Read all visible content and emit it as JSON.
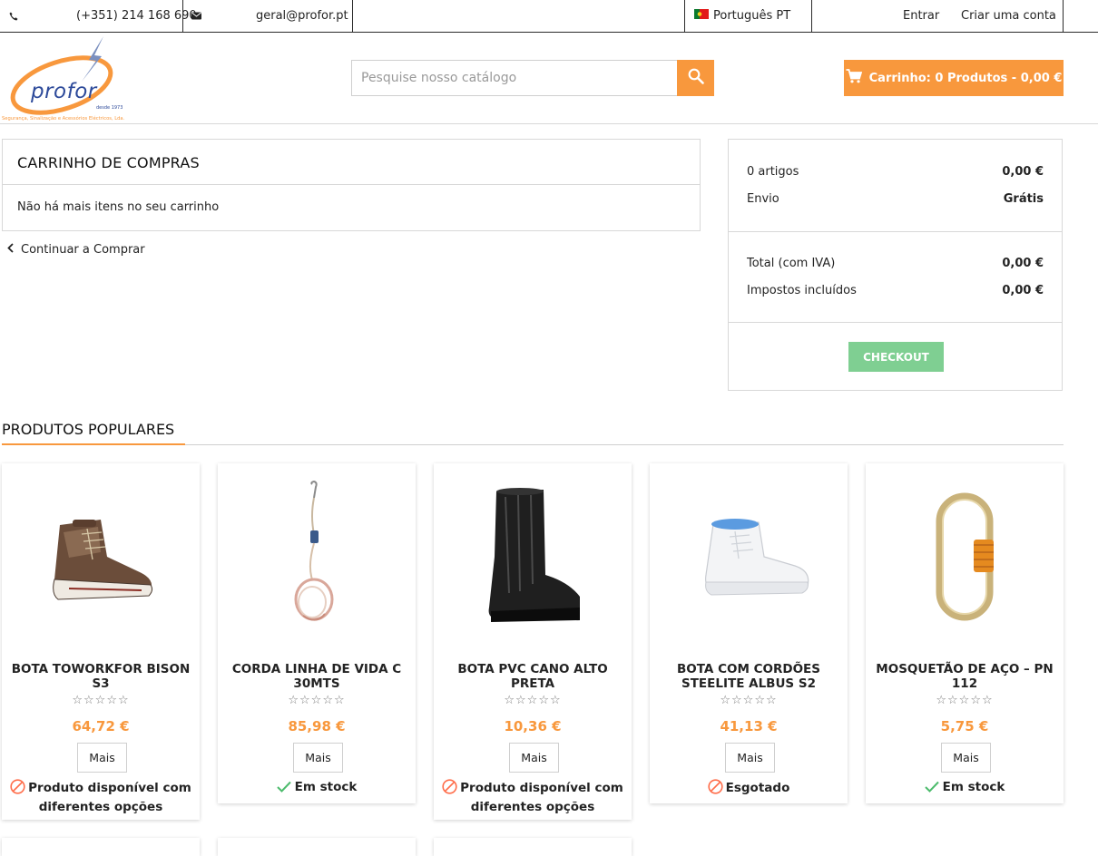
{
  "topbar": {
    "phone": "(+351) 214 168 690",
    "email": "geral@profor.pt",
    "language": "Português PT",
    "login": "Entrar",
    "register": "Criar uma conta"
  },
  "header": {
    "logo_text": "profor",
    "logo_since": "desde 1973",
    "logo_tagline": "Segurança, Sinalização e Acessórios Eléctricos, Lda.",
    "search_placeholder": "Pesquise nosso catálogo",
    "cart_label": "Carrinho: 0 Produtos - 0,00 €"
  },
  "cart": {
    "title": "CARRINHO DE COMPRAS",
    "empty_message": "Não há mais itens no seu carrinho",
    "continue_label": "Continuar a Comprar"
  },
  "summary": {
    "items_label": "0 artigos",
    "items_value": "0,00 €",
    "shipping_label": "Envio",
    "shipping_value": "Grátis",
    "total_label": "Total (com IVA)",
    "total_value": "0,00 €",
    "taxes_label": "Impostos incluídos",
    "taxes_value": "0,00 €",
    "checkout_label": "CHECKOUT"
  },
  "popular": {
    "title": "PRODUTOS POPULARES",
    "more_label": "Mais",
    "stars": "☆☆☆☆☆",
    "products": [
      {
        "name": "BOTA TOWORKFOR BISON S3",
        "price": "64,72 €",
        "availability": "Produto disponível com diferentes opções",
        "status": "options",
        "image": "brown-work-boot"
      },
      {
        "name": "CORDA LINHA DE VIDA C 30MTS",
        "price": "85,98 €",
        "availability": "Em stock",
        "status": "in-stock",
        "image": "lifeline-rope"
      },
      {
        "name": "BOTA PVC CANO ALTO PRETA",
        "price": "10,36 €",
        "availability": "Produto disponível com diferentes opções",
        "status": "options",
        "image": "black-rubber-boot"
      },
      {
        "name": "BOTA COM CORDÕES STEELITE ALBUS S2",
        "price": "41,13 €",
        "availability": "Esgotado",
        "status": "out-of-stock",
        "image": "white-safety-boot"
      },
      {
        "name": "MOSQUETÃO DE AÇO – PN 112",
        "price": "5,75 €",
        "availability": "Em stock",
        "status": "in-stock",
        "image": "steel-carabiner"
      }
    ]
  },
  "colors": {
    "accent": "#f8983d",
    "checkout": "#7fcf92",
    "in_stock": "#4cbb6c",
    "unavailable": "#ff6d4a"
  }
}
